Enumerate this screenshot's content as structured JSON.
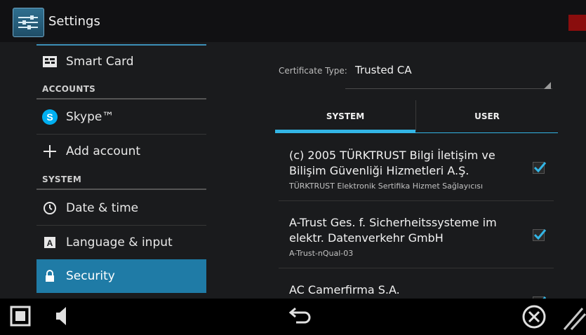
{
  "app": {
    "title": "Settings",
    "icon": "settings-app-icon"
  },
  "sidebar": {
    "items": [
      {
        "label": "Smart Card",
        "icon": "smart-card-icon"
      },
      {
        "label": "Skype™",
        "icon": "skype-icon"
      },
      {
        "label": "Add account",
        "icon": "add-icon"
      },
      {
        "label": "Date & time",
        "icon": "clock-icon"
      },
      {
        "label": "Language & input",
        "icon": "keyboard-icon"
      },
      {
        "label": "Security",
        "icon": "lock-icon"
      }
    ],
    "sections": {
      "accounts": "ACCOUNTS",
      "system": "SYSTEM"
    },
    "active": "Security"
  },
  "pane": {
    "cert_type_label": "Certificate Type:",
    "cert_type_value": "Trusted CA",
    "tabs": [
      {
        "label": "SYSTEM",
        "selected": true
      },
      {
        "label": "USER",
        "selected": false
      }
    ],
    "certificates": [
      {
        "title": "(c) 2005 TÜRKTRUST Bilgi İletişim ve Bilişim Güvenliği Hizmetleri A.Ş.",
        "subtitle": "TÜRKTRUST Elektronik Sertifika Hizmet Sağlayıcısı",
        "checked": true
      },
      {
        "title": "A-Trust Ges. f. Sicherheitssysteme im elektr. Datenverkehr GmbH",
        "subtitle": "A-Trust-nQual-03",
        "checked": true
      },
      {
        "title": "AC Camerfirma S.A.",
        "subtitle": "",
        "checked": true
      }
    ]
  },
  "navbar": {
    "buttons": [
      "recent-apps-icon",
      "volume-icon",
      "back-icon",
      "close-icon",
      "resize-grip-icon"
    ]
  },
  "colors": {
    "accent": "#33b5e5",
    "selected": "#1f7ba6",
    "background": "#1a1b1d"
  }
}
